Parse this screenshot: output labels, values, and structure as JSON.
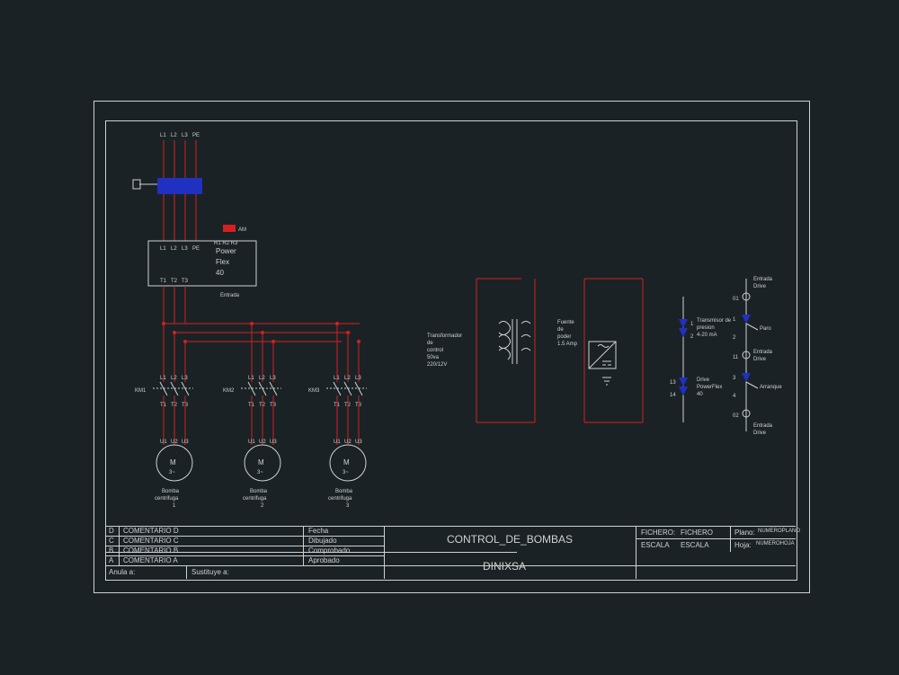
{
  "title_block": {
    "project_title": "CONTROL_DE_BOMBAS",
    "company": "DINIXSA",
    "fichero_label": "FICHERO:",
    "fichero_value": "FICHERO",
    "escala_label": "ESCALA",
    "escala_value": "ESCALA",
    "plano_label": "Plano:",
    "plano_value": "NUMEROPLANO",
    "hoja_label": "Hoja:",
    "hoja_value": "NUMEROHOJA",
    "revisions": [
      {
        "idx": "D",
        "label": "COMENTARIO D"
      },
      {
        "idx": "C",
        "label": "COMENTARIO C"
      },
      {
        "idx": "B",
        "label": "COMENTARIO B"
      },
      {
        "idx": "A",
        "label": "COMENTARIO A"
      }
    ],
    "fecha": "Fecha",
    "dibujado": "Dibujado",
    "comprobado": "Comprobado",
    "aprobado": "Aprobado",
    "anula": "Anula a:",
    "sustituye": "Sustituye a:"
  },
  "power_inputs": [
    "L1",
    "L2",
    "L3",
    "PE"
  ],
  "drive": {
    "label1": "Power",
    "label2": "Flex",
    "label3": "40",
    "inputs": [
      "L1",
      "L2",
      "L3",
      "PE"
    ],
    "outputs": [
      "T1",
      "T2",
      "T3"
    ],
    "aux": "R1 R2 R3"
  },
  "motors": [
    {
      "label": "M",
      "sub": "3~",
      "name1": "Bomba",
      "name2": "centrifuga",
      "num": "1",
      "terms": [
        "U1",
        "U2",
        "U3"
      ],
      "in": [
        "L1",
        "L2",
        "L3"
      ],
      "out": [
        "T1",
        "T2",
        "T3"
      ]
    },
    {
      "label": "M",
      "sub": "3~",
      "name1": "Bomba",
      "name2": "centrifuga",
      "num": "2",
      "terms": [
        "U1",
        "U2",
        "U3"
      ],
      "in": [
        "L1",
        "L2",
        "L3"
      ],
      "out": [
        "T1",
        "T2",
        "T3"
      ]
    },
    {
      "label": "M",
      "sub": "3~",
      "name1": "Bomba",
      "name2": "centrifuga",
      "num": "3",
      "terms": [
        "U1",
        "U2",
        "U3"
      ],
      "in": [
        "L1",
        "L2",
        "L3"
      ],
      "out": [
        "T1",
        "T2",
        "T3"
      ]
    }
  ],
  "contactor_refs": [
    "KM1",
    "KM2",
    "KM3"
  ],
  "transformer": {
    "label1": "Transformador",
    "label2": "de",
    "label3": "control",
    "label4": "50va",
    "label5": "220/12V"
  },
  "fuente": {
    "label1": "Fuente",
    "label2": "de",
    "label3": "poder",
    "label4": "1.5 Amp"
  },
  "control_right": {
    "top": "Transmisor de",
    "top2": "presion",
    "top3": "4-20 mA",
    "bottom": "Drive",
    "bottom2": "PowerFlex",
    "bottom3": "40"
  },
  "buttons": {
    "entrada_top": "Entrada",
    "drive_top": "Drive",
    "paro": "Paro",
    "entrada_mid": "Entrada",
    "drive_mid": "Drive",
    "arranque": "Arranque",
    "entrada_bot": "Entrada",
    "drive_bot": "Drive",
    "terms": [
      "01",
      "1",
      "2",
      "11",
      "3",
      "4",
      "02"
    ]
  },
  "misc": {
    "am": "AM",
    "entrada_vfd": "Entrada"
  }
}
